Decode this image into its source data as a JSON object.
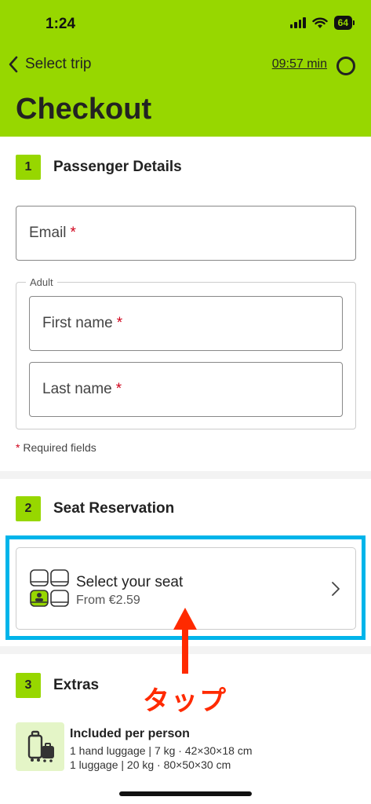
{
  "status_bar": {
    "time": "1:24",
    "battery": "64"
  },
  "nav": {
    "back_label": "Select trip",
    "timer": "09:57 min"
  },
  "page": {
    "title": "Checkout"
  },
  "sections": {
    "passenger": {
      "number": "1",
      "title": "Passenger Details",
      "email_label": "Email",
      "group_label": "Adult",
      "first_name_label": "First name",
      "last_name_label": "Last name",
      "required_mark": "*",
      "required_note": "Required fields"
    },
    "seat": {
      "number": "2",
      "title": "Seat Reservation",
      "card_title": "Select your seat",
      "card_price": "From €2.59"
    },
    "extras": {
      "number": "3",
      "title": "Extras",
      "included_title": "Included per person",
      "included_lines": [
        "1 hand luggage | 7 kg · 42×30×18 cm",
        "1 luggage | 20 kg · 80×50×30 cm"
      ]
    }
  },
  "annotation": {
    "label": "タップ",
    "color": "#ff2a00",
    "highlight_color": "#00b4ea"
  },
  "colors": {
    "brand": "#97d700",
    "required": "#d0021b"
  }
}
